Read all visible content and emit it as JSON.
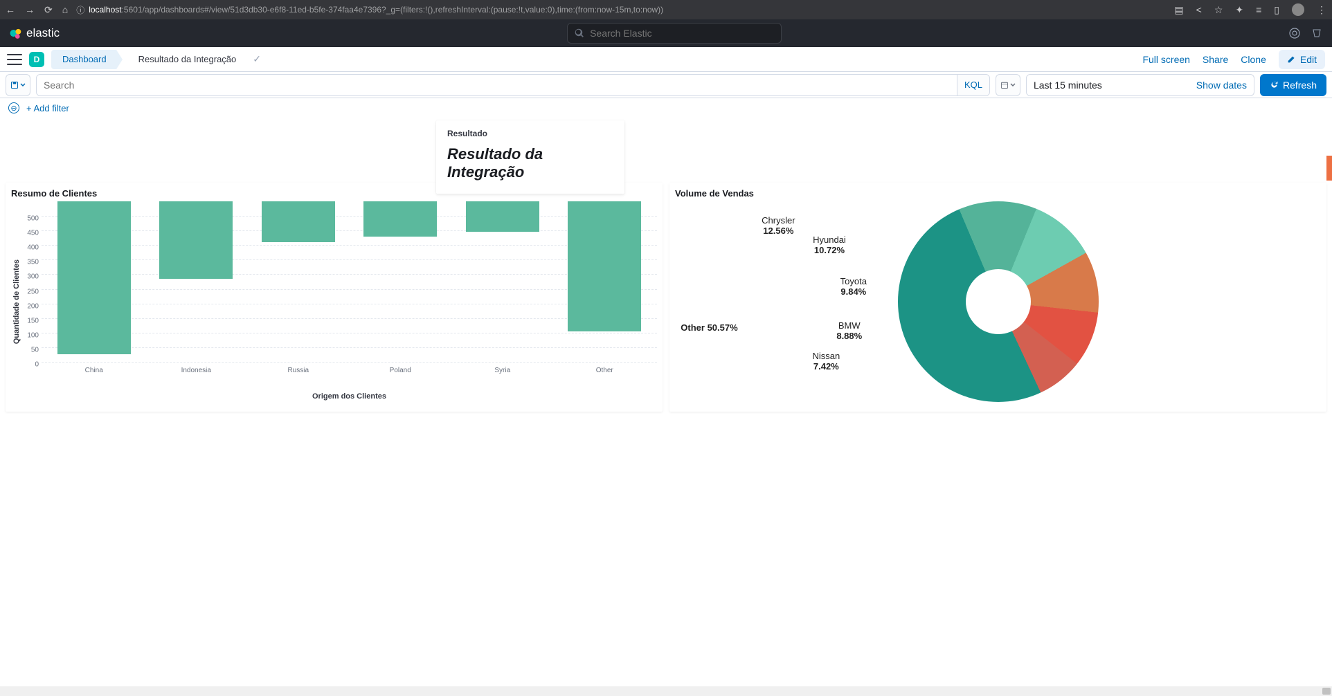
{
  "browser": {
    "url_host": "localhost",
    "url_path": ":5601/app/dashboards#/view/51d3db30-e6f8-11ed-b5fe-374faa4e7396?_g=(filters:!(),refreshInterval:(pause:!t,value:0),time:(from:now-15m,to:now))"
  },
  "kibana": {
    "brand": "elastic",
    "search_placeholder": "Search Elastic"
  },
  "breadcrumb": {
    "space_initial": "D",
    "dashboard_label": "Dashboard",
    "current_label": "Resultado da Integração"
  },
  "actions": {
    "fullscreen": "Full screen",
    "share": "Share",
    "clone": "Clone",
    "edit": "Edit"
  },
  "query": {
    "placeholder": "Search",
    "kql": "KQL",
    "time_label": "Last 15 minutes",
    "show_dates": "Show dates",
    "refresh": "Refresh"
  },
  "filter": {
    "add": "+ Add filter"
  },
  "title_card": {
    "label": "Resultado",
    "text": "Resultado da Integração"
  },
  "panels": {
    "bar": {
      "title": "Resumo de Clientes"
    },
    "pie": {
      "title": "Volume de Vendas"
    }
  },
  "chart_data": [
    {
      "type": "bar",
      "title": "Resumo de Clientes",
      "xlabel": "Origem dos Clientes",
      "ylabel": "Quantidade de Clientes",
      "categories": [
        "China",
        "Indonesia",
        "Russia",
        "Poland",
        "Syria",
        "Other"
      ],
      "values": [
        525,
        265,
        140,
        120,
        105,
        445
      ],
      "ylim": [
        0,
        550
      ],
      "yticks": [
        0,
        50,
        100,
        150,
        200,
        250,
        300,
        350,
        400,
        450,
        500
      ]
    },
    {
      "type": "pie",
      "title": "Volume de Vendas",
      "series": [
        {
          "name": "Other",
          "value": 50.57,
          "color": "#1c9385"
        },
        {
          "name": "Chrysler",
          "value": 12.56,
          "color": "#54b399"
        },
        {
          "name": "Hyundai",
          "value": 10.72,
          "color": "#6dccb1"
        },
        {
          "name": "Toyota",
          "value": 9.84,
          "color": "#d87a4a"
        },
        {
          "name": "BMW",
          "value": 8.88,
          "color": "#e25242"
        },
        {
          "name": "Nissan",
          "value": 7.42,
          "color": "#d36051"
        }
      ]
    }
  ]
}
